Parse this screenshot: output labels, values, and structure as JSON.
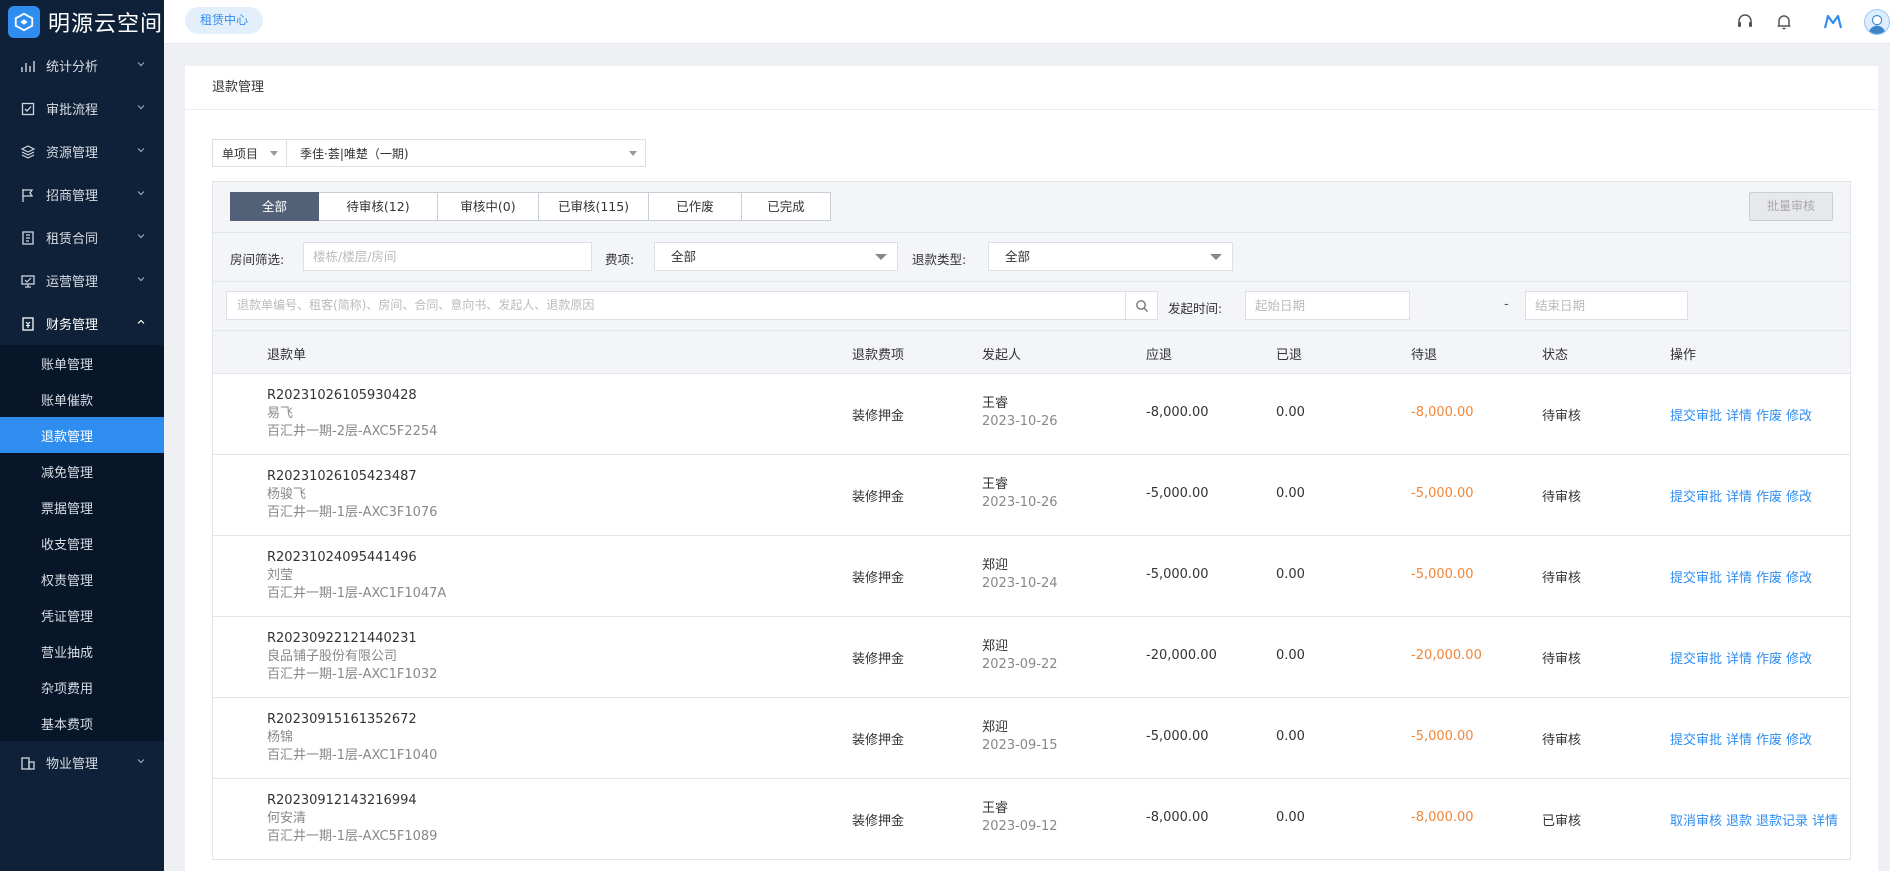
{
  "app": {
    "name": "明源云空间"
  },
  "sidebar": {
    "items": [
      {
        "label": "统计分析",
        "icon": "chart-icon"
      },
      {
        "label": "审批流程",
        "icon": "checkbox-icon"
      },
      {
        "label": "资源管理",
        "icon": "layers-icon"
      },
      {
        "label": "招商管理",
        "icon": "flag-icon"
      },
      {
        "label": "租赁合同",
        "icon": "contract-icon"
      },
      {
        "label": "运营管理",
        "icon": "monitor-icon"
      },
      {
        "label": "财务管理",
        "icon": "finance-icon"
      }
    ],
    "finance_sub": [
      {
        "label": "账单管理"
      },
      {
        "label": "账单催款"
      },
      {
        "label": "退款管理"
      },
      {
        "label": "减免管理"
      },
      {
        "label": "票据管理"
      },
      {
        "label": "收支管理"
      },
      {
        "label": "权责管理"
      },
      {
        "label": "凭证管理"
      },
      {
        "label": "营业抽成"
      },
      {
        "label": "杂项费用"
      },
      {
        "label": "基本费项"
      }
    ],
    "last_item": {
      "label": "物业管理",
      "icon": "property-icon"
    },
    "active_sub": "退款管理"
  },
  "topbar": {
    "tab_label": "租赁中心"
  },
  "page": {
    "title": "退款管理",
    "project_mode": "单项目",
    "project_name": "季佳·荟|唯楚（一期)"
  },
  "tabs": [
    {
      "label": "全部",
      "active": true
    },
    {
      "label": "待审核(12)"
    },
    {
      "label": "审核中(0)"
    },
    {
      "label": "已审核(115)"
    },
    {
      "label": "已作废"
    },
    {
      "label": "已完成"
    }
  ],
  "batch_button": "批量审核",
  "filters": {
    "room_label": "房间筛选:",
    "room_placeholder": "楼栋/楼层/房间",
    "fee_label": "费项:",
    "fee_value": "全部",
    "refund_type_label": "退款类型:",
    "refund_type_value": "全部",
    "search_placeholder": "退款单编号、租客(简称)、房间、合同、意向书、发起人、退款原因",
    "date_label": "发起时间:",
    "start_placeholder": "起始日期",
    "end_placeholder": "结束日期",
    "date_sep": "-"
  },
  "table": {
    "headers": [
      "退款单",
      "退款费项",
      "发起人",
      "应退",
      "已退",
      "待退",
      "状态",
      "操作"
    ],
    "rows": [
      {
        "code": "R20231026105930428",
        "tenant": "易飞",
        "room": "百汇井一期-2层-AXC5F2254",
        "fee": "装修押金",
        "initiator": "王睿",
        "date": "2023-10-26",
        "due": "-8,000.00",
        "paid": "0.00",
        "pending": "-8,000.00",
        "status": "待审核",
        "ops": [
          "提交审批",
          "详情",
          "作废",
          "修改"
        ]
      },
      {
        "code": "R20231026105423487",
        "tenant": "杨骏飞",
        "room": "百汇井一期-1层-AXC3F1076",
        "fee": "装修押金",
        "initiator": "王睿",
        "date": "2023-10-26",
        "due": "-5,000.00",
        "paid": "0.00",
        "pending": "-5,000.00",
        "status": "待审核",
        "ops": [
          "提交审批",
          "详情",
          "作废",
          "修改"
        ]
      },
      {
        "code": "R20231024095441496",
        "tenant": "刘莹",
        "room": "百汇井一期-1层-AXC1F1047A",
        "fee": "装修押金",
        "initiator": "郑迎",
        "date": "2023-10-24",
        "due": "-5,000.00",
        "paid": "0.00",
        "pending": "-5,000.00",
        "status": "待审核",
        "ops": [
          "提交审批",
          "详情",
          "作废",
          "修改"
        ]
      },
      {
        "code": "R20230922121440231",
        "tenant": "良品铺子股份有限公司",
        "room": "百汇井一期-1层-AXC1F1032",
        "fee": "装修押金",
        "initiator": "郑迎",
        "date": "2023-09-22",
        "due": "-20,000.00",
        "paid": "0.00",
        "pending": "-20,000.00",
        "status": "待审核",
        "ops": [
          "提交审批",
          "详情",
          "作废",
          "修改"
        ]
      },
      {
        "code": "R20230915161352672",
        "tenant": "杨锦",
        "room": "百汇井一期-1层-AXC1F1040",
        "fee": "装修押金",
        "initiator": "郑迎",
        "date": "2023-09-15",
        "due": "-5,000.00",
        "paid": "0.00",
        "pending": "-5,000.00",
        "status": "待审核",
        "ops": [
          "提交审批",
          "详情",
          "作废",
          "修改"
        ]
      },
      {
        "code": "R20230912143216994",
        "tenant": "何安清",
        "room": "百汇井一期-1层-AXC5F1089",
        "fee": "装修押金",
        "initiator": "王睿",
        "date": "2023-09-12",
        "due": "-8,000.00",
        "paid": "0.00",
        "pending": "-8,000.00",
        "status": "已审核",
        "ops": [
          "取消审核",
          "退款",
          "退款记录",
          "详情"
        ]
      }
    ]
  },
  "colors": {
    "accent": "#2f8df0",
    "sidebar_bg": "#0f2138",
    "pending_amount": "#f0863b",
    "active_tab": "#536178"
  }
}
